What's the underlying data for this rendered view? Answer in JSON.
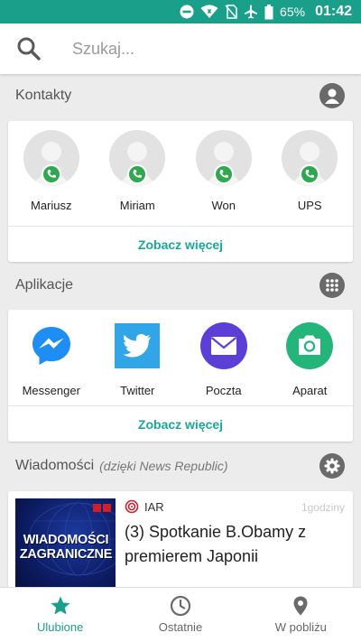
{
  "status_bar": {
    "battery": "65%",
    "time": "01:42",
    "icons": [
      "do-not-disturb-icon",
      "wifi-icon",
      "no-sim-icon",
      "airplane-icon",
      "battery-icon"
    ]
  },
  "search": {
    "placeholder": "Szukaj..."
  },
  "contacts_section": {
    "title": "Kontakty",
    "action_icon": "contacts-icon",
    "items": [
      {
        "name": "Mariusz"
      },
      {
        "name": "Miriam"
      },
      {
        "name": "Won"
      },
      {
        "name": "UPS"
      }
    ],
    "more_label": "Zobacz więcej"
  },
  "apps_section": {
    "title": "Aplikacje",
    "action_icon": "apps-grid-icon",
    "items": [
      {
        "name": "Messenger",
        "icon": "messenger-icon"
      },
      {
        "name": "Twitter",
        "icon": "twitter-icon"
      },
      {
        "name": "Poczta",
        "icon": "mail-icon"
      },
      {
        "name": "Aparat",
        "icon": "camera-icon"
      }
    ],
    "more_label": "Zobacz więcej"
  },
  "news_section": {
    "title": "Wiadomości",
    "subtitle": "(dzięki News Republic)",
    "action_icon": "settings-icon",
    "article": {
      "thumbnail_text": "WIADOMOŚCI ZAGRANICZNE",
      "source": "IAR",
      "time": "1godziny",
      "headline": "(3) Spotkanie B.Obamy z premierem Japonii"
    }
  },
  "bottom_nav": {
    "items": [
      {
        "label": "Ulubione",
        "icon": "star-icon",
        "active": true
      },
      {
        "label": "Ostatnie",
        "icon": "clock-icon",
        "active": false
      },
      {
        "label": "W pobliżu",
        "icon": "location-pin-icon",
        "active": false
      }
    ]
  },
  "colors": {
    "accent": "#1a9f8a",
    "link": "#1ba897",
    "status_bar": "#1a9f8a",
    "phone_badge": "#2fa84f"
  }
}
